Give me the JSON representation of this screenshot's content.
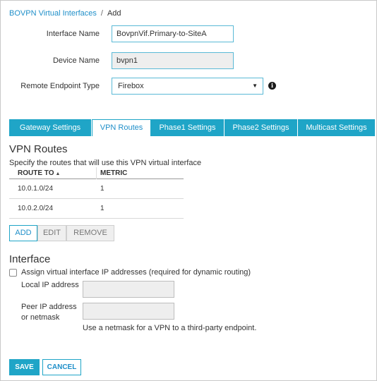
{
  "breadcrumb": {
    "parent": "BOVPN Virtual Interfaces",
    "separator": "/",
    "current": "Add"
  },
  "form": {
    "interface_name_label": "Interface Name",
    "interface_name_value": "BovpnVif.Primary-to-SiteA",
    "device_name_label": "Device Name",
    "device_name_value": "bvpn1",
    "remote_endpoint_label": "Remote Endpoint Type",
    "remote_endpoint_value": "Firebox",
    "info_glyph": "i"
  },
  "tabs": [
    {
      "label": "Gateway Settings"
    },
    {
      "label": "VPN Routes"
    },
    {
      "label": "Phase1 Settings"
    },
    {
      "label": "Phase2 Settings"
    },
    {
      "label": "Multicast Settings"
    }
  ],
  "active_tab": "VPN Routes",
  "vpn_routes": {
    "title": "VPN Routes",
    "description": "Specify the routes that will use this VPN virtual interface",
    "columns": [
      "ROUTE TO",
      "METRIC"
    ],
    "sort_glyph": "▲",
    "rows": [
      {
        "route_to": "10.0.1.0/24",
        "metric": "1"
      },
      {
        "route_to": "10.0.2.0/24",
        "metric": "1"
      }
    ],
    "buttons": {
      "add": "ADD",
      "edit": "EDIT",
      "remove": "REMOVE"
    }
  },
  "interface": {
    "title": "Interface",
    "assign_checkbox_label": "Assign virtual interface IP addresses (required for dynamic routing)",
    "assign_checked": false,
    "local_ip_label": "Local IP address",
    "peer_ip_label_line1": "Peer IP address",
    "peer_ip_label_line2": "or netmask",
    "netmask_hint": "Use a netmask for a VPN to a third-party endpoint."
  },
  "footer": {
    "save": "SAVE",
    "cancel": "CANCEL"
  },
  "colors": {
    "accent": "#1fa5c7",
    "link": "#1f8fc9",
    "input_border": "#5ab9d6",
    "readonly_bg": "#eeeeee"
  },
  "icons": {
    "info": "info-circle-icon",
    "sort": "sort-ascending-icon",
    "dropdown": "chevron-down-icon"
  }
}
